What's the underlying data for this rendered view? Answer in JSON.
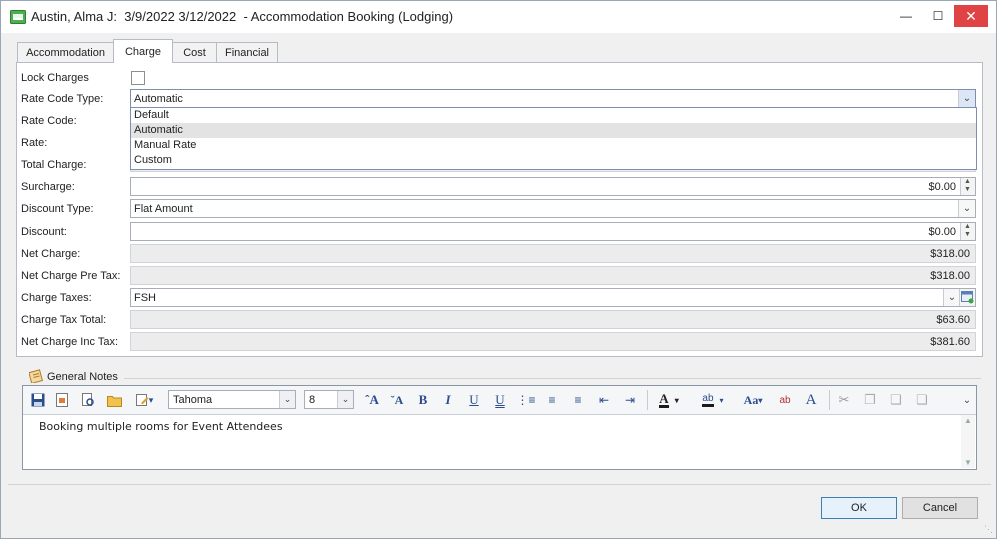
{
  "window": {
    "title": "Austin, Alma J:  3/9/2022 3/12/2022  - Accommodation Booking (Lodging)",
    "icon": "bed-icon",
    "controls": {
      "minimize": "—",
      "maximize": "☐",
      "close": "✕"
    }
  },
  "tabs": [
    {
      "label": "Accommodation",
      "active": false
    },
    {
      "label": "Charge",
      "active": true
    },
    {
      "label": "Cost",
      "active": false
    },
    {
      "label": "Financial",
      "active": false
    }
  ],
  "form": {
    "lock_charges": {
      "label": "Lock Charges",
      "checked": false
    },
    "rate_code_type": {
      "label": "Rate Code Type:",
      "value": "Automatic"
    },
    "rate_code": {
      "label": "Rate Code:"
    },
    "rate": {
      "label": "Rate:"
    },
    "total_charge": {
      "label": "Total Charge:"
    },
    "surcharge": {
      "label": "Surcharge:",
      "value": "$0.00"
    },
    "discount_type": {
      "label": "Discount Type:",
      "value": "Flat Amount"
    },
    "discount": {
      "label": "Discount:",
      "value": "$0.00"
    },
    "net_charge": {
      "label": "Net Charge:",
      "value": "$318.00"
    },
    "net_charge_pre_tax": {
      "label": "Net Charge Pre Tax:",
      "value": "$318.00"
    },
    "charge_taxes": {
      "label": "Charge Taxes:",
      "value": "FSH"
    },
    "charge_tax_total": {
      "label": "Charge Tax Total:",
      "value": "$63.60"
    },
    "net_charge_inc_tax": {
      "label": "Net Charge Inc Tax:",
      "value": "$381.60"
    }
  },
  "dropdown": {
    "options": [
      "Default",
      "Automatic",
      "Manual Rate",
      "Custom"
    ],
    "highlighted": "Automatic"
  },
  "notes": {
    "title": "General Notes",
    "font_name": "Tahoma",
    "font_size": "8",
    "text": "Booking multiple rooms for Event Attendees"
  },
  "buttons": {
    "ok": "OK",
    "cancel": "Cancel"
  },
  "colors": {
    "close_button": "#e04343",
    "ok_border": "#3c7fb1",
    "dropdown_border": "#7d8fb0"
  }
}
